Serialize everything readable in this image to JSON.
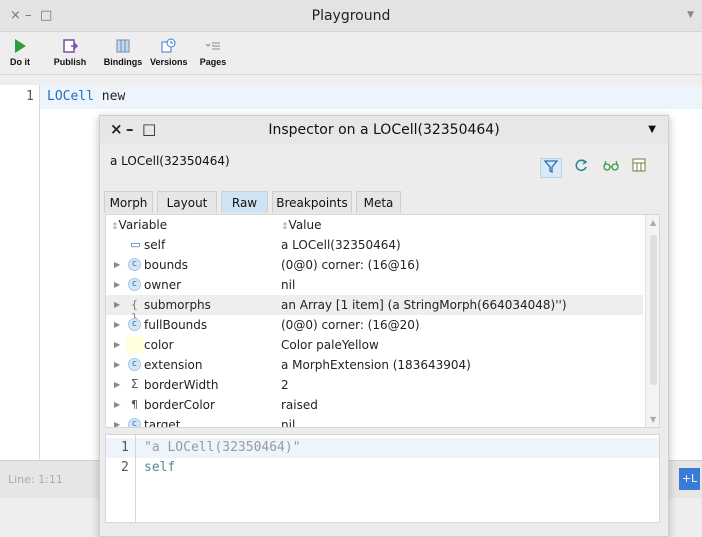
{
  "playground": {
    "title": "Playground",
    "controls": {
      "close": "×",
      "minimize": "–",
      "maximize": "□"
    },
    "toolbar": [
      {
        "label": "Do it",
        "icon": "play-icon"
      },
      {
        "label": "Publish",
        "icon": "publish-icon"
      },
      {
        "label": "Bindings",
        "icon": "bindings-icon"
      },
      {
        "label": "Versions",
        "icon": "versions-icon"
      },
      {
        "label": "Pages",
        "icon": "pages-icon"
      }
    ],
    "editor": {
      "lines": [
        {
          "number": "1",
          "text": "LOCell new"
        }
      ]
    },
    "status": {
      "line_info": "Line: 1:11",
      "mode_button": "+L"
    }
  },
  "inspector": {
    "title": "Inspector on a LOCell(32350464)",
    "controls": {
      "close": "×",
      "minimize": "–",
      "maximize": "□"
    },
    "subtitle": "a LOCell(32350464)",
    "tabs": [
      "Morph",
      "Layout",
      "Raw",
      "Breakpoints",
      "Meta"
    ],
    "active_tab": "Raw",
    "columns": {
      "variable": "Variable",
      "value": "Value"
    },
    "rows": [
      {
        "name": "self",
        "value": "a LOCell(32350464)",
        "icon": "self-icon",
        "expandable": false
      },
      {
        "name": "bounds",
        "value": "(0@0) corner: (16@16)",
        "icon": "class-c-icon",
        "expandable": true
      },
      {
        "name": "owner",
        "value": "nil",
        "icon": "class-c-icon",
        "expandable": true
      },
      {
        "name": "submorphs",
        "value": "an Array [1 item] (a StringMorph(664034048)'')",
        "icon": "braces-icon",
        "expandable": true
      },
      {
        "name": "fullBounds",
        "value": "(0@0) corner: (16@20)",
        "icon": "class-c-icon",
        "expandable": true
      },
      {
        "name": "color",
        "value": "Color paleYellow",
        "icon": "color-swatch-icon",
        "expandable": true,
        "swatch": "#ffffe0"
      },
      {
        "name": "extension",
        "value": "a MorphExtension (183643904)",
        "icon": "class-c-icon",
        "expandable": true
      },
      {
        "name": "borderWidth",
        "value": "2",
        "icon": "sigma-icon",
        "expandable": true
      },
      {
        "name": "borderColor",
        "value": "raised",
        "icon": "pilcrow-icon",
        "expandable": true
      },
      {
        "name": "target",
        "value": "nil",
        "icon": "class-c-icon",
        "expandable": true
      }
    ],
    "evaluator": {
      "lines": [
        {
          "number": "1",
          "text": "\"a LOCell(32350464)\""
        },
        {
          "number": "2",
          "text": "self"
        }
      ]
    }
  },
  "colors": {
    "accent": "#3a7bd5",
    "keyword_blue": "#1f6fbf",
    "comment_gray": "#9a9a9a",
    "play_green": "#2e9e3a",
    "pseudo_var_teal": "#4f8f8f"
  }
}
